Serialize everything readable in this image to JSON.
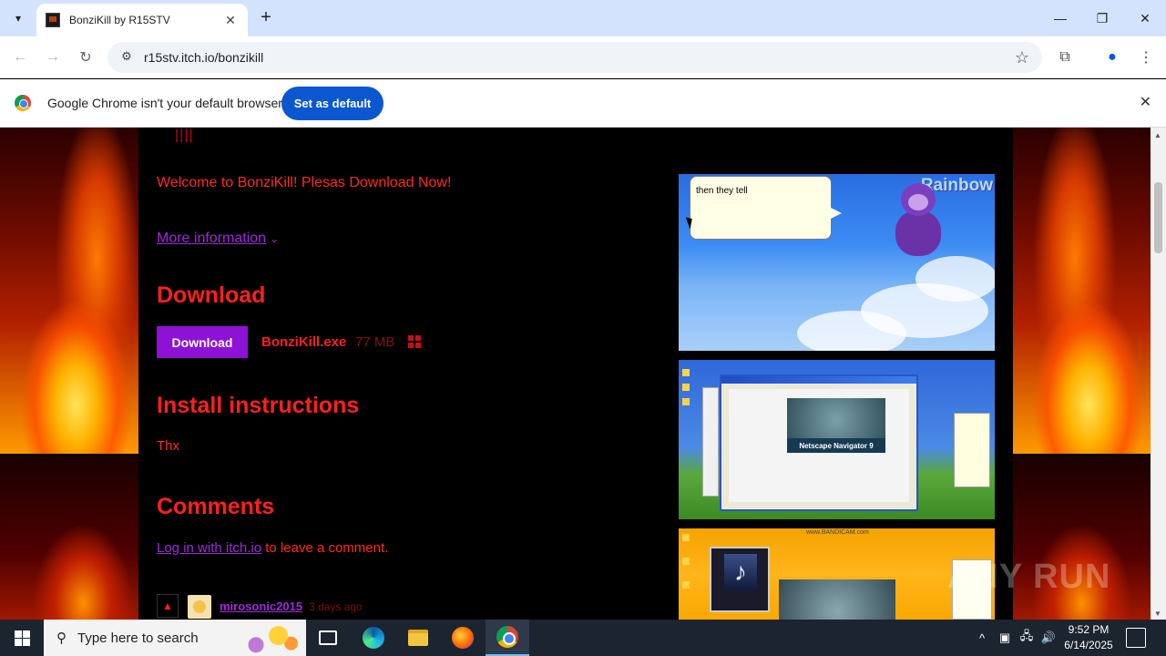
{
  "browser": {
    "tab_title": "BonziKill by R15STV",
    "tab_close": "✕",
    "new_tab": "+",
    "url": "r15stv.itch.io/bonzikill",
    "window_controls": {
      "minimize": "—",
      "restore": "❐",
      "close": "✕"
    }
  },
  "infobar": {
    "message": "Google Chrome isn't your default browser",
    "button_label": "Set as default",
    "close": "✕"
  },
  "page": {
    "welcome_text": "Welcome to BonziKill! Plesas Download Now!",
    "more_info_label": "More information",
    "download_heading": "Download",
    "download_button": "Download",
    "file_name": "BonziKill.exe",
    "file_size": "77 MB",
    "install_heading": "Install instructions",
    "install_text": "Thx",
    "comments_heading": "Comments",
    "login_link": "Log in with itch.io",
    "login_suffix": " to leave a comment.",
    "comment": {
      "username": "mirosonic2015",
      "time": "3 days ago"
    },
    "accent_color": "#ff1f1f",
    "link_color": "#9d2bd9"
  },
  "screenshots": {
    "shot1_bubble_text": "then they tell",
    "shot1_overlay": "Rainbow",
    "shot2_label": "Netscape Navigator 9",
    "shot3_caption": "www.BANDICAM.com"
  },
  "taskbar": {
    "search_placeholder": "Type here to search",
    "time": "9:52 PM",
    "date": "6/14/2025"
  },
  "watermark": "ANY RUN"
}
